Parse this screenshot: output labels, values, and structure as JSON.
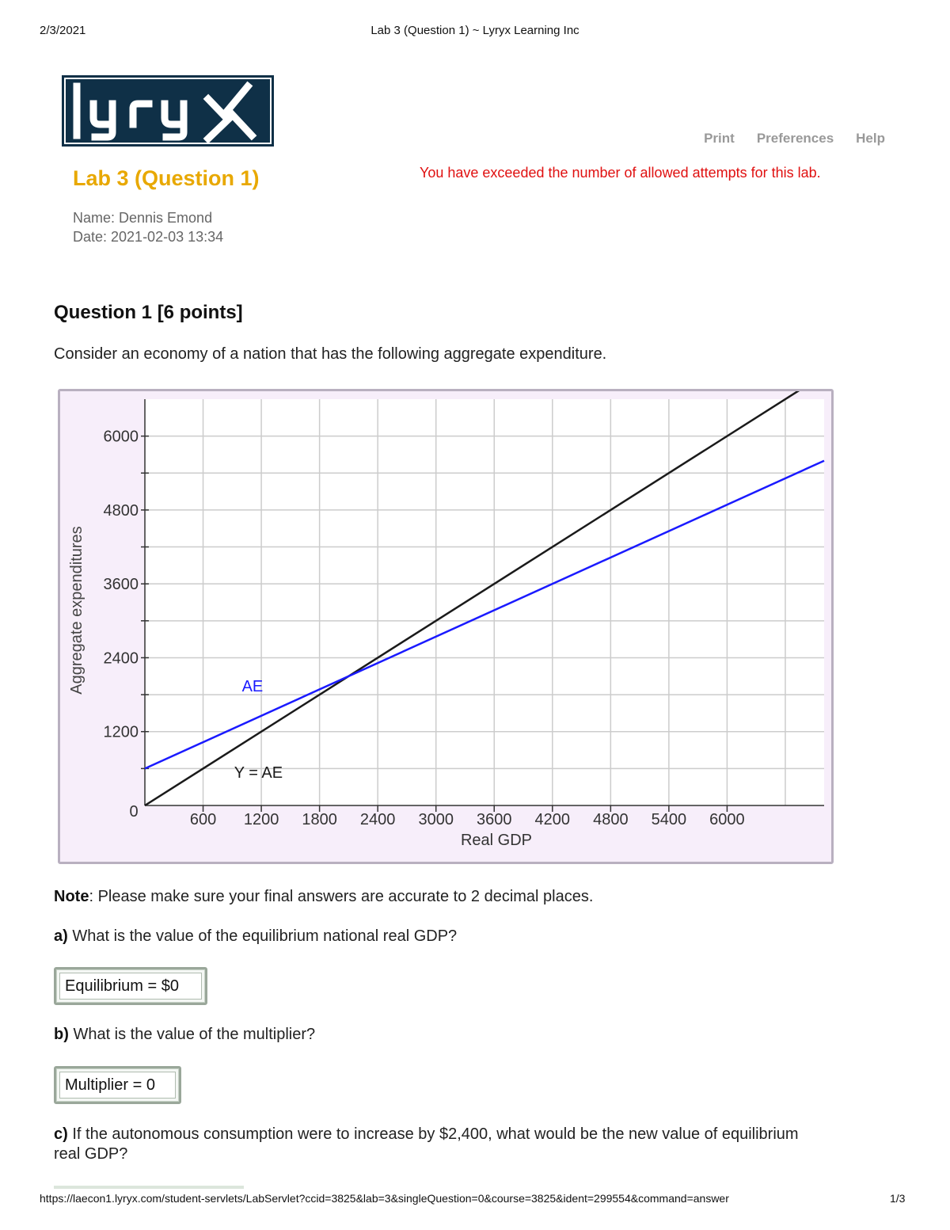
{
  "print_header": {
    "date": "2/3/2021",
    "title": "Lab 3 (Question 1) ~ Lyryx Learning Inc"
  },
  "logo": {
    "text": "lyryx",
    "bg_color": "#0f3047"
  },
  "nav": {
    "print": "Print",
    "preferences": "Preferences",
    "help": "Help"
  },
  "lab_title": "Lab 3 (Question 1)",
  "warning": "You have exceeded the number of allowed attempts for this lab.",
  "meta": {
    "name": "Name: Dennis Emond",
    "date": "Date: 2021-02-03 13:34"
  },
  "question": {
    "title": "Question 1 [6 points]",
    "intro": "Consider an economy of a nation that has the following aggregate expenditure.",
    "note_label": "Note",
    "note_text": ": Please make sure your final answers are accurate to 2 decimal places.",
    "a_label": "a)",
    "a_text": " What is the value of the equilibrium national real GDP?",
    "a_value": "Equilibrium = $0",
    "b_label": "b)",
    "b_text": " What is the value of the multiplier?",
    "b_value": "Multiplier = 0",
    "c_label": "c)",
    "c_text_1": " If the autonomous consumption were to increase by $2,400, what would be the new value of equilibrium",
    "c_text_2": "real GDP?"
  },
  "chart_data": {
    "type": "line",
    "xlabel": "Real GDP",
    "ylabel": "Aggregate expenditures",
    "xlim": [
      0,
      7000
    ],
    "ylim": [
      0,
      6600
    ],
    "xticks": [
      600,
      1200,
      1800,
      2400,
      3000,
      3600,
      4200,
      4800,
      5400,
      6000
    ],
    "yticks": [
      1200,
      2400,
      3600,
      4800,
      6000
    ],
    "origin_label": "0",
    "grid": true,
    "series": [
      {
        "name": "Y = AE",
        "color": "#1a1a1a",
        "x": [
          0,
          7000
        ],
        "y": [
          0,
          7000
        ]
      },
      {
        "name": "AE",
        "color": "#1a1aff",
        "x": [
          0,
          7000
        ],
        "y": [
          600,
          5600
        ]
      }
    ],
    "annotations": [
      {
        "text": "AE",
        "x": 1000,
        "y": 1850,
        "color": "#1a1aff"
      },
      {
        "text": "Y = AE",
        "x": 920,
        "y": 450,
        "color": "#1a1a1a"
      }
    ]
  },
  "footer": {
    "url": "https://laecon1.lyryx.com/student-servlets/LabServlet?ccid=3825&lab=3&singleQuestion=0&course=3825&ident=299554&command=answer",
    "page": "1/3"
  }
}
